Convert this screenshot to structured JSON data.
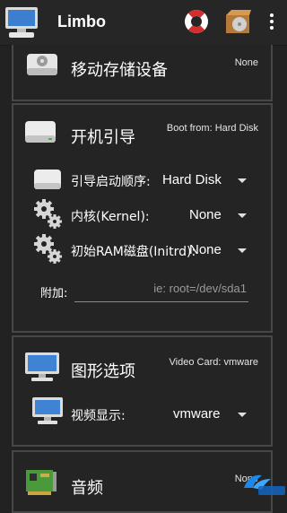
{
  "app": {
    "title": "Limbo"
  },
  "removable": {
    "title": "移动存储设备",
    "status": "None"
  },
  "boot": {
    "title": "开机引导",
    "status": "Boot from: Hard Disk",
    "boot_order": {
      "label": "引导启动顺序:",
      "value": "Hard Disk"
    },
    "kernel": {
      "label": "内核(Kernel):",
      "value": "None"
    },
    "initrd": {
      "label": "初始RAM磁盘(Initrd):",
      "value": "None"
    },
    "append": {
      "label": "附加:",
      "placeholder": "ie: root=/dev/sda1"
    }
  },
  "graphics": {
    "title": "图形选项",
    "status": "Video Card: vmware",
    "display": {
      "label": "视频显示:",
      "value": "vmware"
    }
  },
  "audio": {
    "title": "音频",
    "status": "None"
  },
  "colors": {
    "background": "#222222",
    "card_border": "#474747",
    "text": "#ffffff",
    "muted": "#9a9a9a"
  }
}
